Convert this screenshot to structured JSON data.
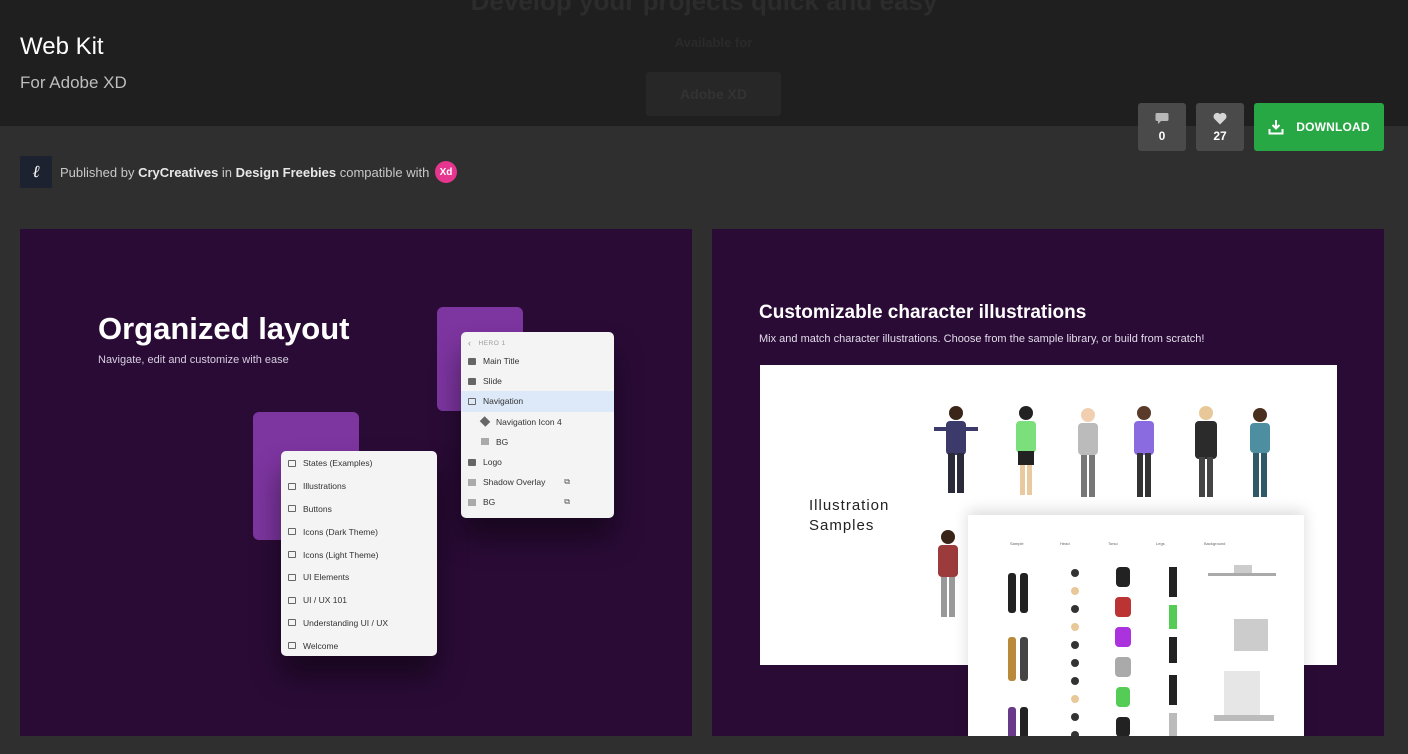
{
  "header": {
    "ghost_title": "Develop your projects quick and easy",
    "ghost_available": "Available for",
    "ghost_button": "Adobe XD",
    "title": "Web Kit",
    "subtitle": "For Adobe XD"
  },
  "actions": {
    "comments_icon": "comment-icon",
    "comments_count": "0",
    "likes_icon": "heart-icon",
    "likes_count": "27",
    "download_icon": "download-icon",
    "download_label": "DOWNLOAD",
    "download_color": "#27a844"
  },
  "publisher": {
    "avatar_glyph": "ℓ",
    "prefix": "Published by",
    "author": "CryCreatives",
    "in_text": "in",
    "category": "Design Freebies",
    "compat_text": "compatible with",
    "badge": "Xd",
    "badge_color": "#e6358f"
  },
  "card_left": {
    "title": "Organized layout",
    "subtitle": "Navigate, edit and customize with ease",
    "panel_back": {
      "header": "HERO 1",
      "rows": [
        "Main Title",
        "Slide",
        "Navigation",
        "Navigation Icon 4",
        "BG",
        "Logo",
        "Shadow Overlay",
        "BG"
      ]
    },
    "panel_front": {
      "rows": [
        "States (Examples)",
        "Illustrations",
        "Buttons",
        "Icons (Dark Theme)",
        "Icons (Light Theme)",
        "UI Elements",
        "UI / UX 101",
        "Understanding UI / UX",
        "Welcome"
      ]
    },
    "bg_color": "#2a0b36",
    "accent_color": "#7d35a0"
  },
  "card_right": {
    "title": "Customizable character illustrations",
    "subtitle": "Mix and match character illustrations. Choose from the sample library, or build from scratch!",
    "label_line1": "Illustration",
    "label_line2": "Samples",
    "sheet_headers": [
      "Sample",
      "Head",
      "Torso",
      "Legs",
      "Background"
    ]
  }
}
